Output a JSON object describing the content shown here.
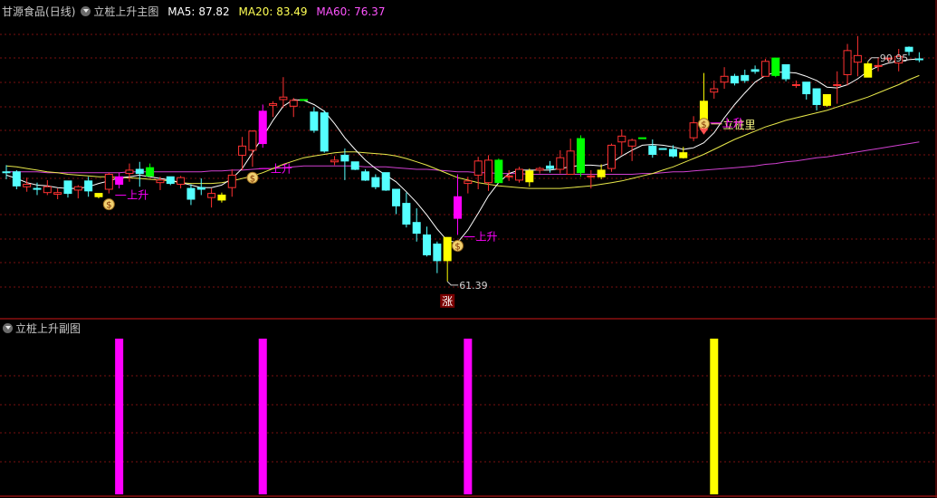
{
  "stock": {
    "name": "甘源食品",
    "period": "(日线)"
  },
  "main_panel": {
    "indicator_name": "立桩上升主图",
    "ma5_label": "MA5:",
    "ma5_value": "87.82",
    "ma20_label": "MA20:",
    "ma20_value": "83.49",
    "ma60_label": "MA60:",
    "ma60_value": "76.37",
    "high_label": "90.95",
    "low_label": "61.39",
    "rise_label": "上升",
    "pile_label": "立桩里",
    "zhang_label": "涨",
    "coin_glyph": "$"
  },
  "sub_panel": {
    "indicator_name": "立桩上升副图"
  },
  "colors": {
    "up": "#ff3232",
    "down": "#54ffff",
    "ma5": "#ffffff",
    "ma20": "#e8e84a",
    "ma60": "#d040d0",
    "magenta": "#ff00ff",
    "yellow": "#ffff00",
    "green": "#00ff00",
    "grid": "#7a1010",
    "border": "#8a1010",
    "header_ma5": "#ffffff",
    "header_ma20": "#ffff54",
    "header_ma60": "#ff54ff"
  },
  "chart_data": [
    {
      "type": "candlestick",
      "title": "立桩上升主图",
      "ylim": [
        58,
        93
      ],
      "candles": [
        {
          "o": 74.6,
          "h": 75.4,
          "l": 73.7,
          "c": 74.6,
          "color": "down"
        },
        {
          "o": 74.6,
          "h": 74.8,
          "l": 72.5,
          "c": 72.9,
          "color": "down"
        },
        {
          "o": 73.1,
          "h": 73.9,
          "l": 72.2,
          "c": 72.8,
          "color": "up"
        },
        {
          "o": 72.6,
          "h": 73.3,
          "l": 71.8,
          "c": 72.5,
          "color": "down"
        },
        {
          "o": 72.1,
          "h": 73.6,
          "l": 71.8,
          "c": 72.8,
          "color": "up"
        },
        {
          "o": 72.1,
          "h": 72.6,
          "l": 71.3,
          "c": 71.9,
          "color": "up"
        },
        {
          "o": 73.5,
          "h": 73.5,
          "l": 71.5,
          "c": 72.0,
          "color": "down"
        },
        {
          "o": 72.4,
          "h": 73.0,
          "l": 71.4,
          "c": 72.8,
          "color": "up"
        },
        {
          "o": 73.5,
          "h": 74.0,
          "l": 71.6,
          "c": 72.3,
          "color": "down"
        },
        {
          "o": 72.0,
          "h": 72.0,
          "l": 71.4,
          "c": 71.6,
          "color": "yellow"
        },
        {
          "o": 72.5,
          "h": 74.5,
          "l": 72.0,
          "c": 74.3,
          "color": "up"
        },
        {
          "o": 74.0,
          "h": 74.5,
          "l": 72.6,
          "c": 73.1,
          "color": "magenta"
        },
        {
          "o": 74.8,
          "h": 75.6,
          "l": 73.4,
          "c": 74.4,
          "color": "up"
        },
        {
          "o": 74.4,
          "h": 75.8,
          "l": 72.8,
          "c": 74.9,
          "color": "down"
        },
        {
          "o": 75.1,
          "h": 75.6,
          "l": 74.0,
          "c": 74.1,
          "color": "green"
        },
        {
          "o": 73.6,
          "h": 74.0,
          "l": 72.4,
          "c": 73.3,
          "color": "up"
        },
        {
          "o": 74.0,
          "h": 74.0,
          "l": 73.0,
          "c": 73.2,
          "color": "down"
        },
        {
          "o": 73.9,
          "h": 74.1,
          "l": 72.6,
          "c": 73.1,
          "color": "up"
        },
        {
          "o": 72.6,
          "h": 73.1,
          "l": 70.6,
          "c": 71.3,
          "color": "down"
        },
        {
          "o": 72.7,
          "h": 73.8,
          "l": 71.8,
          "c": 72.5,
          "color": "down"
        },
        {
          "o": 71.5,
          "h": 72.6,
          "l": 70.3,
          "c": 72.0,
          "color": "up"
        },
        {
          "o": 71.2,
          "h": 72.1,
          "l": 70.9,
          "c": 71.8,
          "color": "yellow"
        },
        {
          "o": 72.7,
          "h": 74.9,
          "l": 71.6,
          "c": 74.2,
          "color": "up"
        },
        {
          "o": 76.6,
          "h": 78.8,
          "l": 74.8,
          "c": 77.7,
          "color": "up"
        },
        {
          "o": 77.2,
          "h": 79.6,
          "l": 75.2,
          "c": 79.5,
          "color": "up"
        },
        {
          "o": 78.0,
          "h": 82.7,
          "l": 77.5,
          "c": 81.9,
          "color": "magenta"
        },
        {
          "o": 82.6,
          "h": 83.1,
          "l": 81.2,
          "c": 82.8,
          "color": "up"
        },
        {
          "o": 83.6,
          "h": 86.0,
          "l": 82.3,
          "c": 83.3,
          "color": "up"
        },
        {
          "o": 82.5,
          "h": 83.5,
          "l": 81.2,
          "c": 83.2,
          "color": "up"
        },
        {
          "o": 83.3,
          "h": 83.3,
          "l": 83.3,
          "c": 83.3,
          "color": "green"
        },
        {
          "o": 81.8,
          "h": 82.4,
          "l": 79.3,
          "c": 79.6,
          "color": "down"
        },
        {
          "o": 81.7,
          "h": 82.0,
          "l": 76.9,
          "c": 77.1,
          "color": "down"
        },
        {
          "o": 76.0,
          "h": 76.5,
          "l": 75.4,
          "c": 75.8,
          "color": "up"
        },
        {
          "o": 76.6,
          "h": 77.4,
          "l": 73.6,
          "c": 75.9,
          "color": "down"
        },
        {
          "o": 75.8,
          "h": 75.8,
          "l": 74.8,
          "c": 74.9,
          "color": "down"
        },
        {
          "o": 74.6,
          "h": 74.9,
          "l": 73.5,
          "c": 73.6,
          "color": "down"
        },
        {
          "o": 73.9,
          "h": 74.3,
          "l": 72.5,
          "c": 72.8,
          "color": "down"
        },
        {
          "o": 74.5,
          "h": 74.5,
          "l": 72.3,
          "c": 72.4,
          "color": "down"
        },
        {
          "o": 72.5,
          "h": 72.5,
          "l": 69.5,
          "c": 70.5,
          "color": "down"
        },
        {
          "o": 70.8,
          "h": 72.1,
          "l": 67.9,
          "c": 68.3,
          "color": "down"
        },
        {
          "o": 68.5,
          "h": 70.2,
          "l": 66.2,
          "c": 67.2,
          "color": "down"
        },
        {
          "o": 67.0,
          "h": 68.0,
          "l": 64.4,
          "c": 64.6,
          "color": "down"
        },
        {
          "o": 65.9,
          "h": 66.2,
          "l": 62.4,
          "c": 63.9,
          "color": "down"
        },
        {
          "o": 63.9,
          "h": 64.5,
          "l": 61.4,
          "c": 66.7,
          "color": "yellow"
        },
        {
          "o": 69.0,
          "h": 74.3,
          "l": 67.0,
          "c": 71.6,
          "color": "magenta"
        },
        {
          "o": 73.2,
          "h": 74.0,
          "l": 72.0,
          "c": 73.5,
          "color": "up"
        },
        {
          "o": 74.2,
          "h": 76.4,
          "l": 72.5,
          "c": 75.9,
          "color": "up"
        },
        {
          "o": 73.3,
          "h": 76.6,
          "l": 72.3,
          "c": 76.0,
          "color": "up"
        },
        {
          "o": 76.0,
          "h": 76.2,
          "l": 73.3,
          "c": 73.3,
          "color": "green"
        },
        {
          "o": 74.1,
          "h": 74.8,
          "l": 73.5,
          "c": 74.1,
          "color": "up"
        },
        {
          "o": 73.6,
          "h": 75.2,
          "l": 73.3,
          "c": 74.9,
          "color": "up"
        },
        {
          "o": 73.4,
          "h": 75.0,
          "l": 72.8,
          "c": 74.7,
          "color": "yellow"
        },
        {
          "o": 74.8,
          "h": 75.2,
          "l": 74.4,
          "c": 75.0,
          "color": "up"
        },
        {
          "o": 75.3,
          "h": 75.9,
          "l": 74.5,
          "c": 75.0,
          "color": "down"
        },
        {
          "o": 74.9,
          "h": 77.2,
          "l": 74.4,
          "c": 76.3,
          "color": "up"
        },
        {
          "o": 77.1,
          "h": 78.6,
          "l": 74.3,
          "c": 74.3,
          "color": "up"
        },
        {
          "o": 78.6,
          "h": 79.0,
          "l": 74.0,
          "c": 74.5,
          "color": "green"
        },
        {
          "o": 74.1,
          "h": 74.8,
          "l": 72.6,
          "c": 74.1,
          "color": "up"
        },
        {
          "o": 74.8,
          "h": 75.5,
          "l": 73.7,
          "c": 74.0,
          "color": "yellow"
        },
        {
          "o": 75.0,
          "h": 78.0,
          "l": 74.6,
          "c": 77.8,
          "color": "up"
        },
        {
          "o": 78.2,
          "h": 79.7,
          "l": 76.7,
          "c": 78.9,
          "color": "up"
        },
        {
          "o": 77.7,
          "h": 78.6,
          "l": 75.9,
          "c": 78.4,
          "color": "up"
        },
        {
          "o": 78.7,
          "h": 78.7,
          "l": 78.7,
          "c": 78.7,
          "color": "green"
        },
        {
          "o": 77.7,
          "h": 78.5,
          "l": 76.3,
          "c": 76.7,
          "color": "down"
        },
        {
          "o": 77.4,
          "h": 77.4,
          "l": 77.4,
          "c": 77.4,
          "color": "down"
        },
        {
          "o": 77.3,
          "h": 77.8,
          "l": 76.3,
          "c": 76.5,
          "color": "down"
        },
        {
          "o": 76.9,
          "h": 77.6,
          "l": 76.2,
          "c": 76.3,
          "color": "yellow"
        },
        {
          "o": 78.7,
          "h": 81.3,
          "l": 78.3,
          "c": 80.5,
          "color": "up"
        },
        {
          "o": 83.1,
          "h": 86.5,
          "l": 79.8,
          "c": 80.9,
          "color": "yellow"
        },
        {
          "o": 84.6,
          "h": 85.6,
          "l": 83.4,
          "c": 84.2,
          "color": "up"
        },
        {
          "o": 85.4,
          "h": 87.2,
          "l": 84.6,
          "c": 86.1,
          "color": "up"
        },
        {
          "o": 86.1,
          "h": 86.4,
          "l": 85.0,
          "c": 85.3,
          "color": "down"
        },
        {
          "o": 86.2,
          "h": 86.9,
          "l": 85.3,
          "c": 85.6,
          "color": "down"
        },
        {
          "o": 86.9,
          "h": 87.4,
          "l": 86.4,
          "c": 86.7,
          "color": "down"
        },
        {
          "o": 86.1,
          "h": 88.2,
          "l": 86.1,
          "c": 87.9,
          "color": "up"
        },
        {
          "o": 88.3,
          "h": 88.3,
          "l": 86.0,
          "c": 86.2,
          "color": "green"
        },
        {
          "o": 87.5,
          "h": 87.5,
          "l": 85.5,
          "c": 85.8,
          "color": "down"
        },
        {
          "o": 85.1,
          "h": 85.6,
          "l": 84.7,
          "c": 85.0,
          "color": "up"
        },
        {
          "o": 85.4,
          "h": 85.4,
          "l": 83.3,
          "c": 84.0,
          "color": "down"
        },
        {
          "o": 84.6,
          "h": 84.6,
          "l": 82.0,
          "c": 82.7,
          "color": "down"
        },
        {
          "o": 82.6,
          "h": 82.6,
          "l": 82.4,
          "c": 83.9,
          "color": "yellow"
        },
        {
          "o": 85.1,
          "h": 86.7,
          "l": 82.8,
          "c": 85.0,
          "color": "up"
        },
        {
          "o": 86.3,
          "h": 90.0,
          "l": 85.0,
          "c": 89.2,
          "color": "up"
        },
        {
          "o": 87.8,
          "h": 90.95,
          "l": 86.1,
          "c": 88.6,
          "color": "up"
        },
        {
          "o": 87.6,
          "h": 87.9,
          "l": 86.0,
          "c": 86.0,
          "color": "yellow"
        },
        {
          "o": 87.4,
          "h": 88.4,
          "l": 86.7,
          "c": 87.3,
          "color": "up"
        },
        {
          "o": 88.2,
          "h": 88.3,
          "l": 87.8,
          "c": 88.3,
          "color": "up"
        },
        {
          "o": 87.7,
          "h": 89.4,
          "l": 86.7,
          "c": 88.5,
          "color": "up"
        },
        {
          "o": 89.6,
          "h": 89.7,
          "l": 88.6,
          "c": 89.1,
          "color": "down"
        },
        {
          "o": 88.2,
          "h": 89.0,
          "l": 87.8,
          "c": 88.1,
          "color": "down"
        }
      ],
      "ma5": [
        74.2,
        73.8,
        73.3,
        73.0,
        72.9,
        72.7,
        72.6,
        72.6,
        72.8,
        73.2,
        73.5,
        73.9,
        74.0,
        74.2,
        74.0,
        73.8,
        73.6,
        73.3,
        73.0,
        72.7,
        72.7,
        73.0,
        73.8,
        75.0,
        76.9,
        78.8,
        80.8,
        82.5,
        83.3,
        83.2,
        82.7,
        81.9,
        80.4,
        78.7,
        77.3,
        76.0,
        75.0,
        74.2,
        73.4,
        72.2,
        70.9,
        69.4,
        67.7,
        66.3,
        66.1,
        67.6,
        69.6,
        71.7,
        73.3,
        74.4,
        74.8,
        74.8,
        74.8,
        74.8,
        75.0,
        75.2,
        75.4,
        75.4,
        75.3,
        75.7,
        76.5,
        77.2,
        77.8,
        77.9,
        77.8,
        77.6,
        77.3,
        77.5,
        78.1,
        79.3,
        81.1,
        82.7,
        84.1,
        85.4,
        86.2,
        86.6,
        86.6,
        86.5,
        86.1,
        85.6,
        84.8,
        84.7,
        85.1,
        85.8,
        86.7,
        87.3,
        87.7,
        87.9,
        88.1,
        88.2
      ],
      "ma20": [
        75.3,
        75.2,
        75.0,
        74.8,
        74.6,
        74.5,
        74.3,
        74.2,
        74.1,
        74.0,
        74.0,
        73.9,
        73.9,
        73.8,
        73.7,
        73.6,
        73.5,
        73.3,
        73.2,
        73.2,
        73.2,
        73.3,
        73.5,
        73.8,
        74.1,
        74.5,
        75.0,
        75.5,
        75.9,
        76.3,
        76.5,
        76.7,
        76.9,
        77.0,
        77.0,
        76.9,
        76.8,
        76.7,
        76.5,
        76.2,
        75.8,
        75.4,
        74.9,
        74.4,
        73.9,
        73.6,
        73.3,
        73.1,
        72.9,
        72.8,
        72.7,
        72.6,
        72.6,
        72.6,
        72.6,
        72.7,
        72.8,
        72.9,
        73.1,
        73.3,
        73.5,
        73.8,
        74.1,
        74.4,
        74.8,
        75.2,
        75.7,
        76.2,
        76.7,
        77.3,
        77.9,
        78.5,
        79.0,
        79.5,
        80.0,
        80.4,
        80.8,
        81.1,
        81.4,
        81.7,
        82.0,
        82.4,
        82.8,
        83.2,
        83.6,
        84.1,
        84.6,
        85.1,
        85.7,
        86.2
      ],
      "ma60": [
        74.6,
        74.6,
        74.6,
        74.6,
        74.5,
        74.5,
        74.5,
        74.5,
        74.5,
        74.5,
        74.5,
        74.5,
        74.6,
        74.6,
        74.6,
        74.6,
        74.6,
        74.6,
        74.6,
        74.6,
        74.7,
        74.7,
        74.8,
        74.8,
        74.9,
        75.0,
        75.0,
        75.1,
        75.2,
        75.3,
        75.3,
        75.3,
        75.3,
        75.3,
        75.3,
        75.2,
        75.2,
        75.2,
        75.1,
        75.0,
        74.9,
        74.9,
        74.8,
        74.7,
        74.6,
        74.6,
        74.5,
        74.5,
        74.4,
        74.4,
        74.4,
        74.3,
        74.3,
        74.3,
        74.3,
        74.3,
        74.3,
        74.3,
        74.3,
        74.3,
        74.3,
        74.3,
        74.4,
        74.4,
        74.5,
        74.6,
        74.6,
        74.7,
        74.8,
        74.9,
        75.0,
        75.1,
        75.2,
        75.3,
        75.5,
        75.6,
        75.8,
        75.9,
        76.1,
        76.3,
        76.4,
        76.6,
        76.8,
        77.0,
        77.2,
        77.4,
        77.6,
        77.8,
        78.0,
        78.2
      ],
      "signals": [
        {
          "index": 10,
          "type": "rise",
          "label_key": "rise_label"
        },
        {
          "index": 24,
          "type": "rise",
          "label_key": "rise_label"
        },
        {
          "index": 44,
          "type": "rise",
          "label_key": "rise_label"
        },
        {
          "index": 68,
          "type": "pile",
          "label_key": "pile_label"
        },
        {
          "index": 68,
          "type": "rise",
          "label_key": "rise_label"
        }
      ],
      "high_marker_index": 84,
      "low_marker_index": 43
    },
    {
      "type": "bar",
      "title": "立桩上升副图",
      "bars": [
        {
          "index": 11,
          "color": "magenta"
        },
        {
          "index": 25,
          "color": "magenta"
        },
        {
          "index": 45,
          "color": "magenta"
        },
        {
          "index": 69,
          "color": "yellow"
        }
      ]
    }
  ]
}
